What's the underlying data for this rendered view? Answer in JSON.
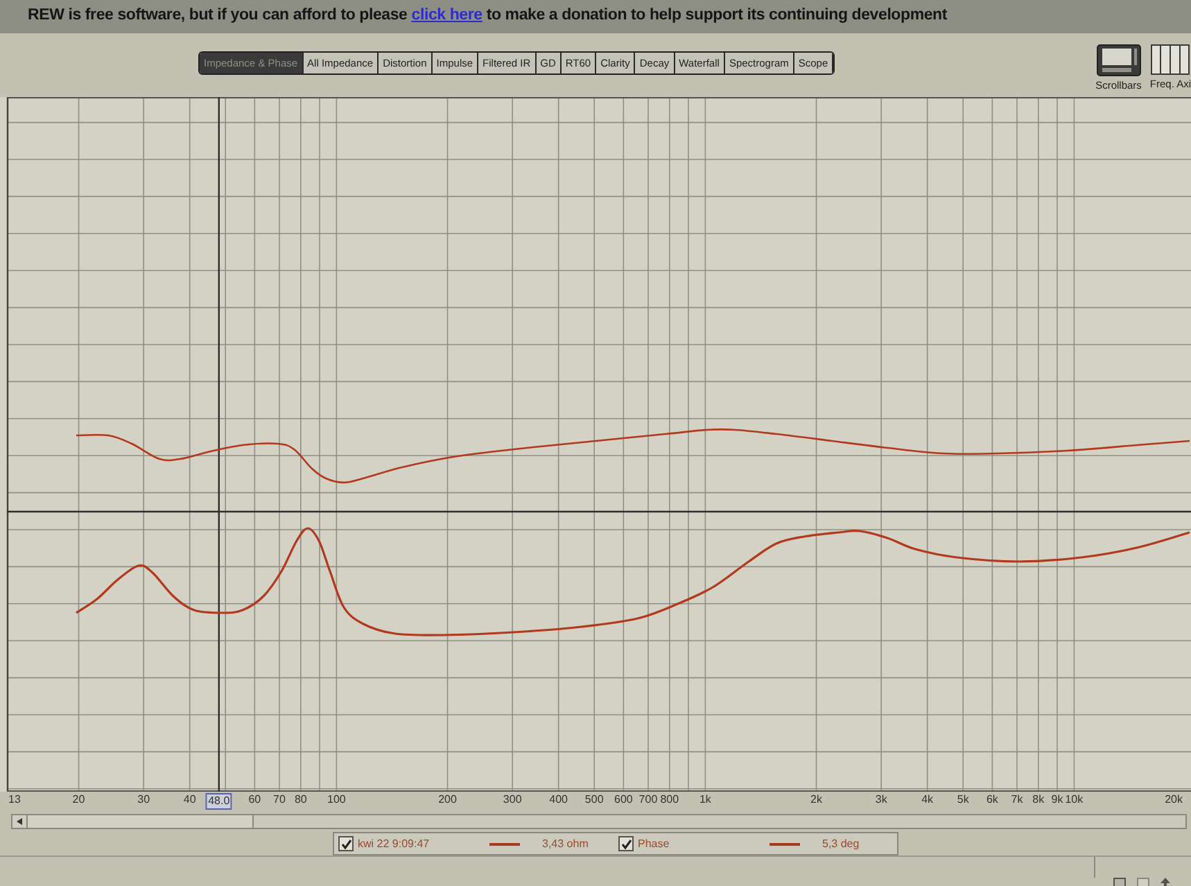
{
  "banner": {
    "text_before": "REW is free software, but if you can afford to please",
    "link": "click here",
    "text_after": "to make a donation to help support its continuing development"
  },
  "tabs": [
    {
      "label": "Impedance & Phase",
      "selected": true
    },
    {
      "label": "All Impedance",
      "selected": false
    },
    {
      "label": "Distortion",
      "selected": false
    },
    {
      "label": "Impulse",
      "selected": false
    },
    {
      "label": "Filtered IR",
      "selected": false
    },
    {
      "label": "GD",
      "selected": false
    },
    {
      "label": "RT60",
      "selected": false
    },
    {
      "label": "Clarity",
      "selected": false
    },
    {
      "label": "Decay",
      "selected": false
    },
    {
      "label": "Waterfall",
      "selected": false
    },
    {
      "label": "Spectrogram",
      "selected": false
    },
    {
      "label": "Scope",
      "selected": false
    }
  ],
  "view_buttons": [
    {
      "label": "Scrollbars",
      "kind": "scrollbars"
    },
    {
      "label": "Freq. Axi",
      "kind": "freq_axis"
    }
  ],
  "plot": {
    "x_axis_labels": [
      "13",
      "20",
      "30",
      "40",
      "60",
      "70",
      "80",
      "100",
      "200",
      "300",
      "400",
      "500",
      "600",
      "700",
      "800",
      "1k",
      "2k",
      "3k",
      "4k",
      "5k",
      "6k",
      "7k",
      "8k",
      "9k",
      "10k",
      "20k"
    ],
    "cursor_label": "48.0"
  },
  "legend": [
    {
      "label": "kwi 22 9:09:47",
      "checked": true,
      "reading": "3,43 ohm"
    },
    {
      "label": "Phase",
      "checked": true,
      "reading": "5,3 deg"
    }
  ]
}
